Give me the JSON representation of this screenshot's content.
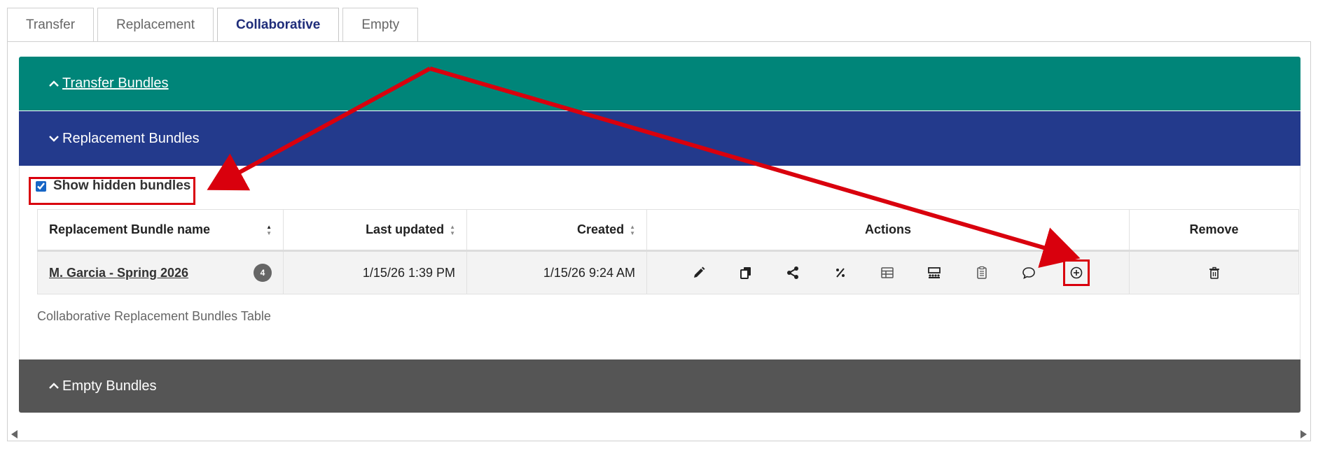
{
  "tabs": [
    {
      "label": "Transfer",
      "active": false
    },
    {
      "label": "Replacement",
      "active": false
    },
    {
      "label": "Collaborative",
      "active": true
    },
    {
      "label": "Empty",
      "active": false
    }
  ],
  "sections": {
    "transfer": {
      "label": " Transfer Bundles",
      "color": "#008579"
    },
    "replacement": {
      "label": "Replacement Bundles",
      "color": "#233a8c"
    },
    "empty": {
      "label": "Empty Bundles",
      "color": "#555555"
    }
  },
  "show_hidden": {
    "label": "Show hidden bundles",
    "checked": true
  },
  "table": {
    "headers": {
      "name": "Replacement Bundle name",
      "last_updated": "Last updated",
      "created": "Created",
      "actions": "Actions",
      "remove": "Remove"
    },
    "rows": [
      {
        "name": "M. Garcia - Spring 2026",
        "count": "4",
        "last_updated": "1/15/26 1:39 PM",
        "created": "1/15/26 9:24 AM",
        "actions": [
          "pencil-icon",
          "copy-icon",
          "share-icon",
          "percent-icon",
          "table-icon",
          "seating-icon",
          "clipboard-icon",
          "comment-icon",
          "add-circle-icon"
        ],
        "remove": "trash-icon"
      }
    ],
    "caption": "Collaborative Replacement Bundles Table"
  },
  "annotation": {
    "color": "#d9000d"
  }
}
